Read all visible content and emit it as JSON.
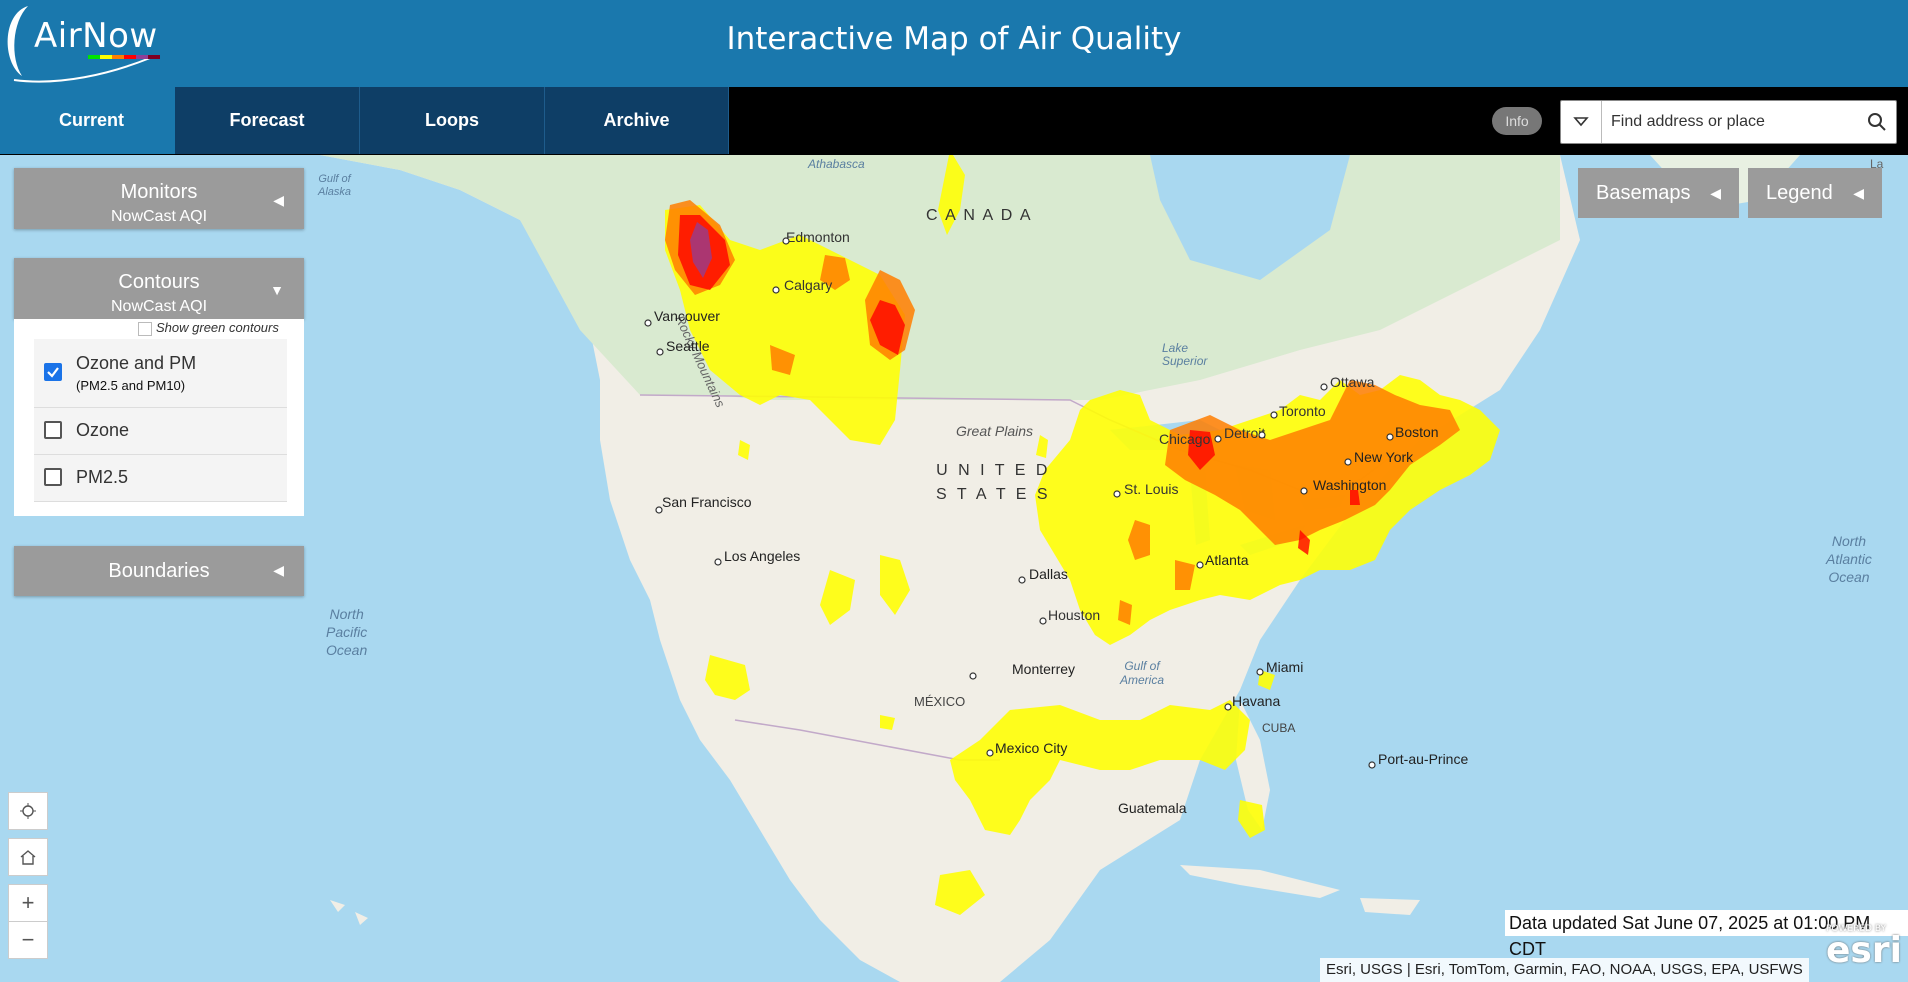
{
  "header": {
    "logo": "AirNow",
    "title": "Interactive Map of Air Quality"
  },
  "nav": {
    "tabs": [
      "Current",
      "Forecast",
      "Loops",
      "Archive"
    ],
    "info_label": "Info",
    "search_placeholder": "Find address or place"
  },
  "panels": {
    "monitors": {
      "title": "Monitors",
      "subtitle": "NowCast AQI"
    },
    "contours": {
      "title": "Contours",
      "subtitle": "NowCast AQI",
      "show_green_label": "Show green contours",
      "options": [
        {
          "label": "Ozone and PM",
          "sub": "(PM2.5 and PM10)",
          "checked": true
        },
        {
          "label": "Ozone",
          "checked": false
        },
        {
          "label": "PM2.5",
          "checked": false
        }
      ]
    },
    "boundaries": {
      "title": "Boundaries"
    }
  },
  "buttons": {
    "basemaps": "Basemaps",
    "legend": "Legend"
  },
  "map": {
    "countries": [
      "C A N A D A",
      "U N I T E D",
      "S T A T E S",
      "MÉXICO",
      "CUBA"
    ],
    "waters": {
      "gulf_alaska": [
        "Gulf of",
        "Alaska"
      ],
      "north_pacific": [
        "North",
        "Pacific",
        "Ocean"
      ],
      "north_atlantic": [
        "North",
        "Atlantic",
        "Ocean"
      ],
      "gulf_america": [
        "Gulf of",
        "America"
      ],
      "lake_superior": [
        "Lake",
        "Superior"
      ]
    },
    "regions": [
      "Athabasca",
      "Rocky Mountains",
      "Great Plains"
    ],
    "cities": [
      "Edmonton",
      "Calgary",
      "Vancouver",
      "Seattle",
      "San Francisco",
      "Los Angeles",
      "Dallas",
      "Houston",
      "Monterrey",
      "Mexico City",
      "Chicago",
      "Detroit",
      "St. Louis",
      "Toronto",
      "Ottawa",
      "Boston",
      "New York",
      "Washington",
      "Atlanta",
      "Miami",
      "Havana",
      "Port-au-Prince",
      "Guatemala",
      "La"
    ],
    "aqi_colors": {
      "moderate": "#ffff00",
      "usg": "#ff7e00",
      "unhealthy": "#ff0000",
      "very_unhealthy": "#8f3f97"
    }
  },
  "footer": {
    "updated": "Data updated Sat June 07, 2025 at 01:00 PM CDT",
    "attribution": "Esri, USGS | Esri, TomTom, Garmin, FAO, NOAA, USGS, EPA, USFWS",
    "esri_logo": "esri",
    "esri_powered": "POWERED BY"
  }
}
